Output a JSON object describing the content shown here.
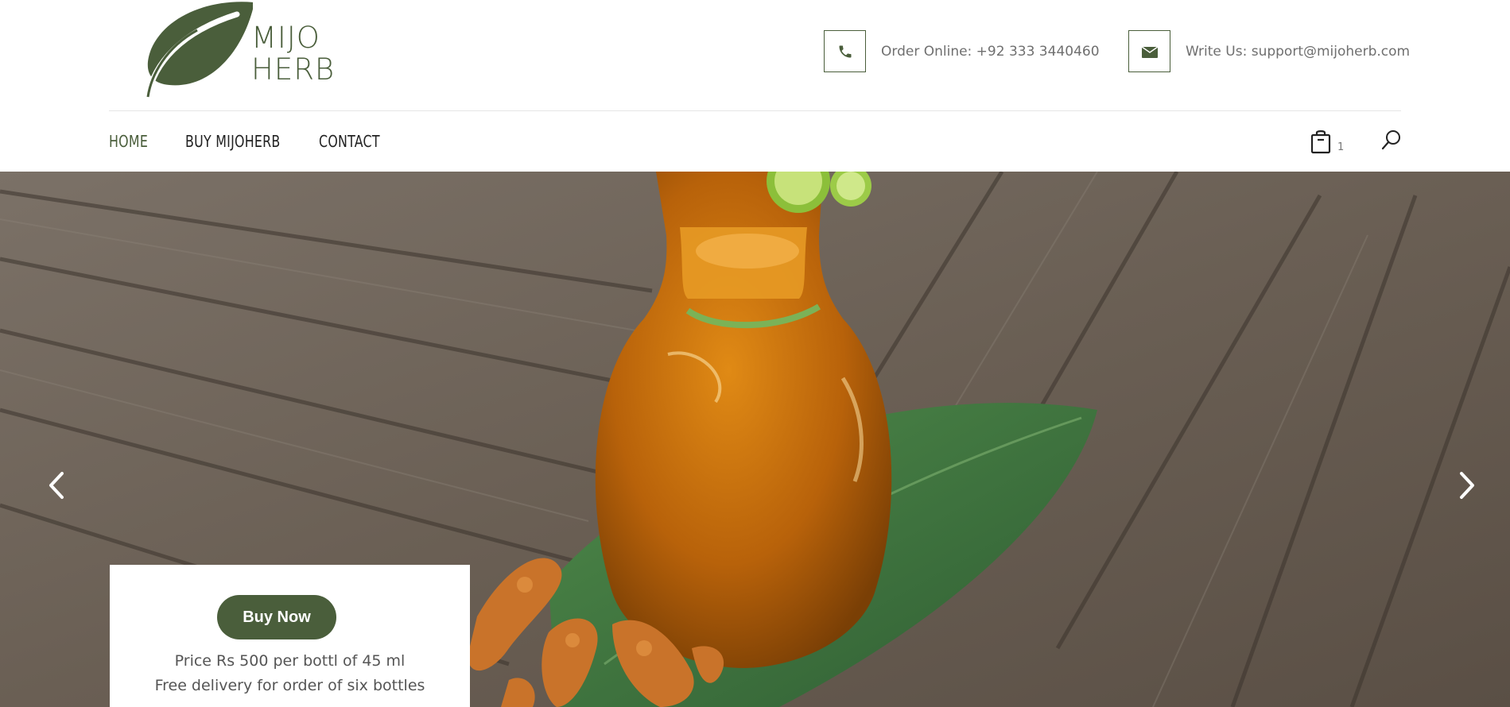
{
  "brand": {
    "line1": "MIJO",
    "line2": "HERB",
    "color": "#4a5e3b"
  },
  "header": {
    "phone": {
      "icon": "phone-icon",
      "text": "Order Online: +92 333 3440460"
    },
    "email": {
      "icon": "envelope-icon",
      "text": "Write Us: support@mijoherb.com"
    }
  },
  "nav": {
    "items": [
      {
        "label": "HOME",
        "active": true
      },
      {
        "label": "BUY MIJOHERB",
        "active": false
      },
      {
        "label": "CONTACT",
        "active": false
      }
    ],
    "cart": {
      "icon": "shopping-bag-icon",
      "count": "1"
    },
    "search": {
      "icon": "search-icon"
    }
  },
  "hero": {
    "prev_icon": "chevron-left-icon",
    "next_icon": "chevron-right-icon",
    "promo": {
      "button_label": "Buy Now",
      "line1": "Price Rs 500 per bottl of 45 ml",
      "line2": "Free delivery for order of six bottles"
    }
  }
}
